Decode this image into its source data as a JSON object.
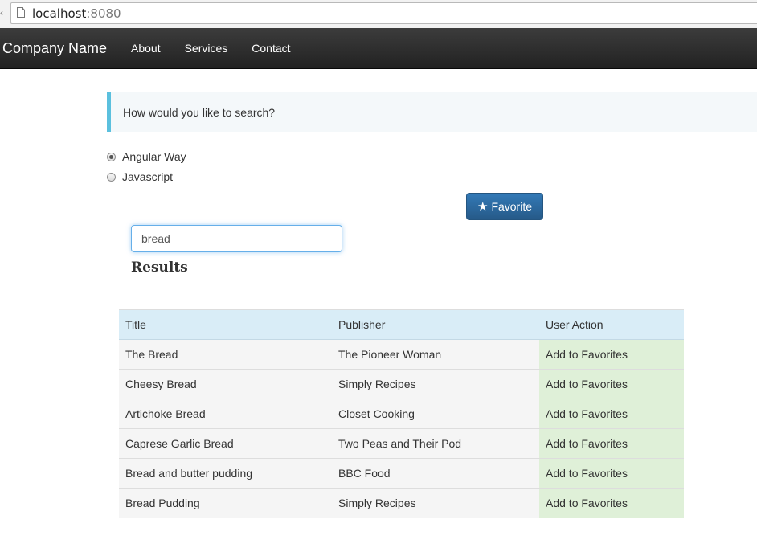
{
  "browser": {
    "url_host": "localhost",
    "url_port": ":8080"
  },
  "navbar": {
    "brand": "Company Name",
    "links": [
      "About",
      "Services",
      "Contact"
    ]
  },
  "search": {
    "prompt": "How would you like to search?",
    "options": [
      "Angular Way",
      "Javascript"
    ],
    "selected_option": "Angular Way",
    "query": "bread"
  },
  "favorite_button": {
    "label": "Favorite",
    "icon": "star-icon"
  },
  "results": {
    "heading": "Results",
    "columns": [
      "Title",
      "Publisher",
      "User Action"
    ],
    "rows": [
      {
        "title": "The Bread",
        "publisher": "The Pioneer Woman",
        "action": "Add to Favorites"
      },
      {
        "title": "Cheesy Bread",
        "publisher": "Simply Recipes",
        "action": "Add to Favorites"
      },
      {
        "title": "Artichoke Bread",
        "publisher": "Closet Cooking",
        "action": "Add to Favorites"
      },
      {
        "title": "Caprese Garlic Bread",
        "publisher": "Two Peas and Their Pod",
        "action": "Add to Favorites"
      },
      {
        "title": "Bread and butter pudding",
        "publisher": "BBC Food",
        "action": "Add to Favorites"
      },
      {
        "title": "Bread Pudding",
        "publisher": "Simply Recipes",
        "action": "Add to Favorites"
      }
    ]
  },
  "colors": {
    "navbar": "#222222",
    "callout_border": "#5bc0de",
    "primary_button": "#337ab7",
    "table_header": "#d9edf7",
    "action_cell": "#dff0d8"
  }
}
